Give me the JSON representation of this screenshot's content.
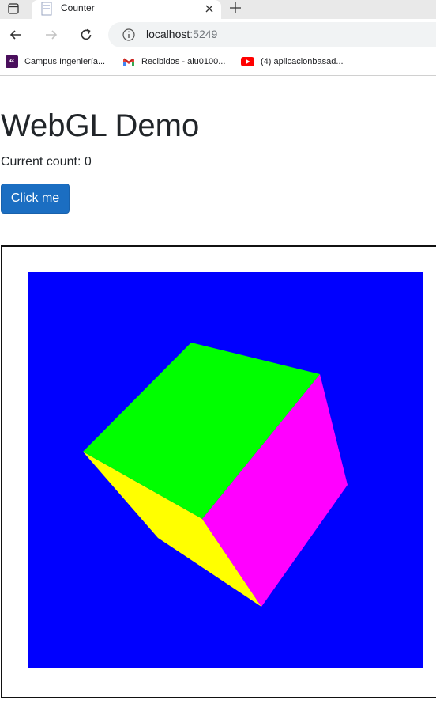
{
  "browser": {
    "tab": {
      "title": "Counter"
    },
    "address": {
      "host": "localhost",
      "port": ":5249"
    },
    "bookmarks": [
      {
        "label": "Campus Ingeniería...",
        "icon": "campus-quote-icon"
      },
      {
        "label": "Recibidos - alu0100...",
        "icon": "gmail-icon"
      },
      {
        "label": "(4) aplicacionbasad...",
        "icon": "youtube-icon"
      }
    ]
  },
  "page": {
    "title": "WebGL Demo",
    "count_label": "Current count: 0",
    "button_label": "Click me"
  },
  "scene": {
    "background_color": "#0000ff",
    "cube_faces": [
      {
        "name": "top",
        "color": "#00ff00"
      },
      {
        "name": "right",
        "color": "#ff00ff"
      },
      {
        "name": "left",
        "color": "#ffff00"
      }
    ]
  },
  "colors": {
    "button": "#1b6ec2",
    "frame_border": "#111111"
  }
}
